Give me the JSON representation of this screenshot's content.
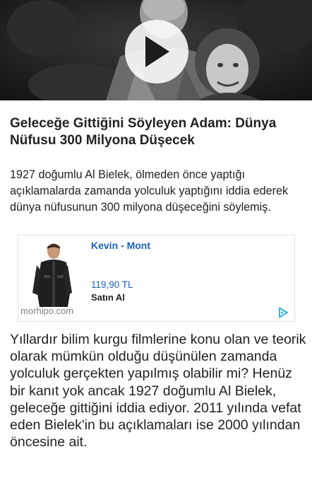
{
  "video": {
    "play_icon": "play-icon"
  },
  "article": {
    "title": "Geleceğe Gittiğini Söyleyen Adam: Dünya Nüfusu 300 Milyona Düşecek",
    "lead": "1927 doğumlu Al Bielek, ölmeden önce yaptığı açıklamalarda zamanda yolculuk yaptığını iddia ederek dünya nüfusunun 300 milyona düşeceğini söylemiş.",
    "body": "Yıllardır bilim kurgu filmlerine konu olan ve teorik olarak mümkün olduğu düşünülen zamanda yolculuk gerçekten yapılmış olabilir mi? Henüz bir kanıt yok ancak 1927 doğumlu Al Bielek, geleceğe gittiğini iddia ediyor. 2011 yılında vefat eden Bielek'in bu açıklamaları ise 2000 yılından öncesine ait."
  },
  "ad": {
    "product_name": "Kevin - Mont",
    "price": "119,90 TL",
    "cta": "Satın Al",
    "source": "morhipo.com",
    "choices_icon": "adchoices-icon"
  },
  "colors": {
    "link_blue": "#1a62b8",
    "text": "#222222",
    "muted": "#808080",
    "adchoices": "#33b6e0"
  }
}
